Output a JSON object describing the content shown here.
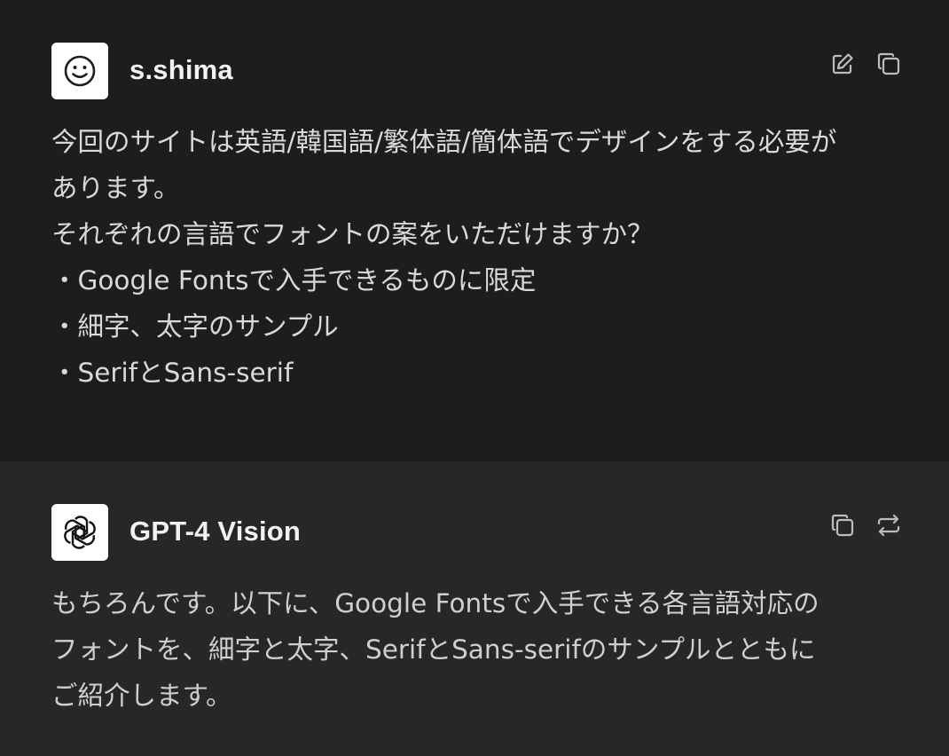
{
  "user_message": {
    "author": "s.shima",
    "lines": [
      "今回のサイトは英語/韓国語/繁体語/簡体語でデザインをする必要が",
      "あります。",
      "それぞれの言語でフォントの案をいただけますか？",
      "・Google Fontsで入手できるものに限定",
      "・細字、太字のサンプル",
      "・SerifとSans-serif"
    ],
    "actions": [
      "edit-icon",
      "copy-icon"
    ]
  },
  "assistant_message": {
    "author": "GPT-4 Vision",
    "lines": [
      "もちろんです。以下に、Google Fontsで入手できる各言語対応の",
      "フォントを、細字と太字、SerifとSans-serifのサンプルとともに",
      "ご紹介します。"
    ],
    "actions": [
      "copy-icon",
      "regenerate-icon"
    ]
  },
  "colors": {
    "user_bg": "#1d1d1d",
    "assistant_bg": "#272727",
    "text": "#d9d9d9",
    "author": "#f2f2f2"
  }
}
